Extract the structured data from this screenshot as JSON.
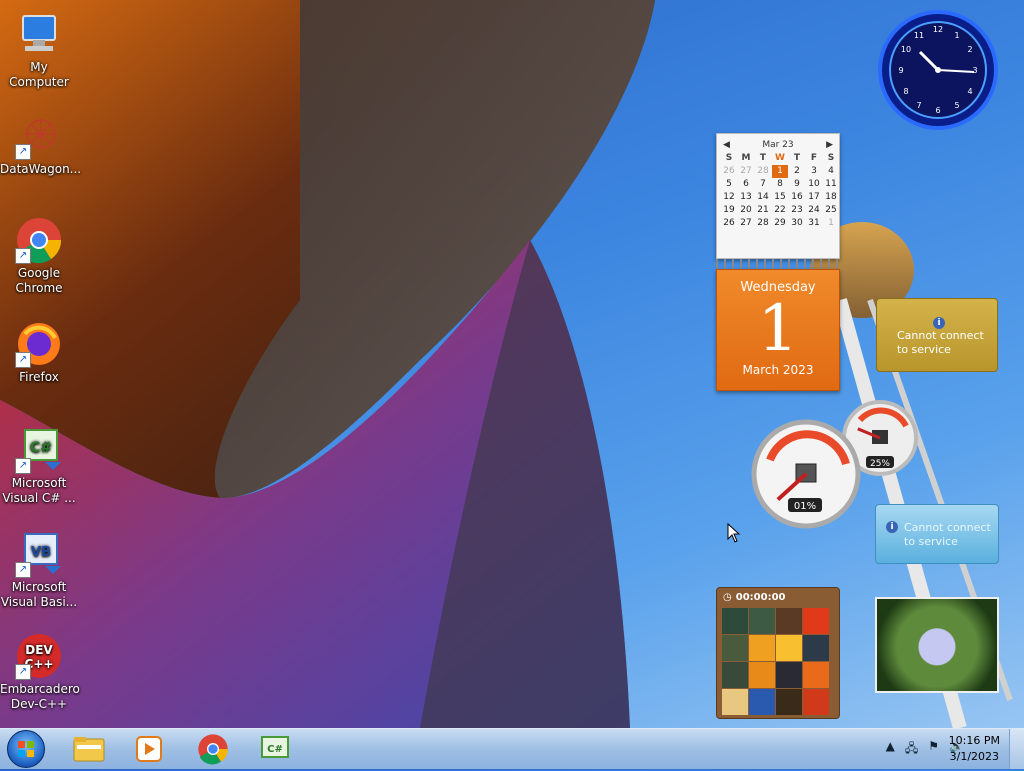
{
  "desktop": {
    "icons": [
      {
        "label": "My Computer"
      },
      {
        "label": "DataWagon..."
      },
      {
        "label": "Google Chrome"
      },
      {
        "label": "Firefox"
      },
      {
        "label": "Microsoft Visual C# ..."
      },
      {
        "label": "Microsoft Visual Basi..."
      },
      {
        "label": "Embarcadero Dev-C++"
      }
    ]
  },
  "gadgets": {
    "calendar": {
      "month_header": "Mar 23",
      "weekdays": [
        "S",
        "M",
        "T",
        "W",
        "T",
        "F",
        "S"
      ],
      "weeks": [
        [
          "26",
          "27",
          "28",
          "1",
          "2",
          "3",
          "4"
        ],
        [
          "5",
          "6",
          "7",
          "8",
          "9",
          "10",
          "11"
        ],
        [
          "12",
          "13",
          "14",
          "15",
          "16",
          "17",
          "18"
        ],
        [
          "19",
          "20",
          "21",
          "22",
          "23",
          "24",
          "25"
        ],
        [
          "26",
          "27",
          "28",
          "29",
          "30",
          "31",
          "1"
        ]
      ],
      "weekday_name": "Wednesday",
      "day_number": "1",
      "month_year": "March 2023"
    },
    "weather_service": {
      "message": "Cannot connect to service"
    },
    "feed_service": {
      "message": "Cannot connect to service"
    },
    "cpu_meter": {
      "cpu_percent": "01%",
      "memory_percent": "25%",
      "cpu_value": 0.01,
      "memory_value": 0.25
    },
    "puzzle": {
      "timer": "00:00:00"
    }
  },
  "taskbar": {
    "pinned": [
      "windows-explorer",
      "media-player",
      "google-chrome",
      "visual-csharp"
    ],
    "clock": {
      "time": "10:16 PM",
      "date": "3/1/2023"
    }
  },
  "colors": {
    "accent_orange": "#e06a12",
    "clock_blue": "#1a2fd6"
  }
}
